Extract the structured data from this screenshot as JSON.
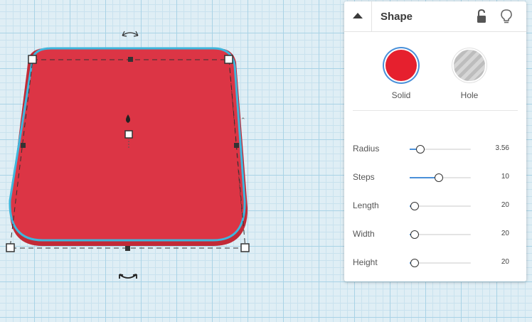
{
  "panel": {
    "title": "Shape",
    "icons": [
      "collapse-arrow-icon",
      "lock-icon",
      "lightbulb-icon"
    ],
    "types": [
      {
        "label": "Solid",
        "color": "#e6202e",
        "selected": true
      },
      {
        "label": "Hole",
        "color": "#c8c8c8",
        "selected": false
      }
    ],
    "properties": [
      {
        "label": "Radius",
        "value": "3.56",
        "level": 0.16
      },
      {
        "label": "Steps",
        "value": "10",
        "level": 0.47
      },
      {
        "label": "Length",
        "value": "20",
        "level": 0.07
      },
      {
        "label": "Width",
        "value": "20",
        "level": 0.07
      },
      {
        "label": "Height",
        "value": "20",
        "level": 0.07
      }
    ]
  },
  "colors": {
    "shape_fill": "#dc3545",
    "shape_outline": "#3fb6dc",
    "grid_bg": "#dfeef5",
    "accent": "#4a90d9"
  }
}
